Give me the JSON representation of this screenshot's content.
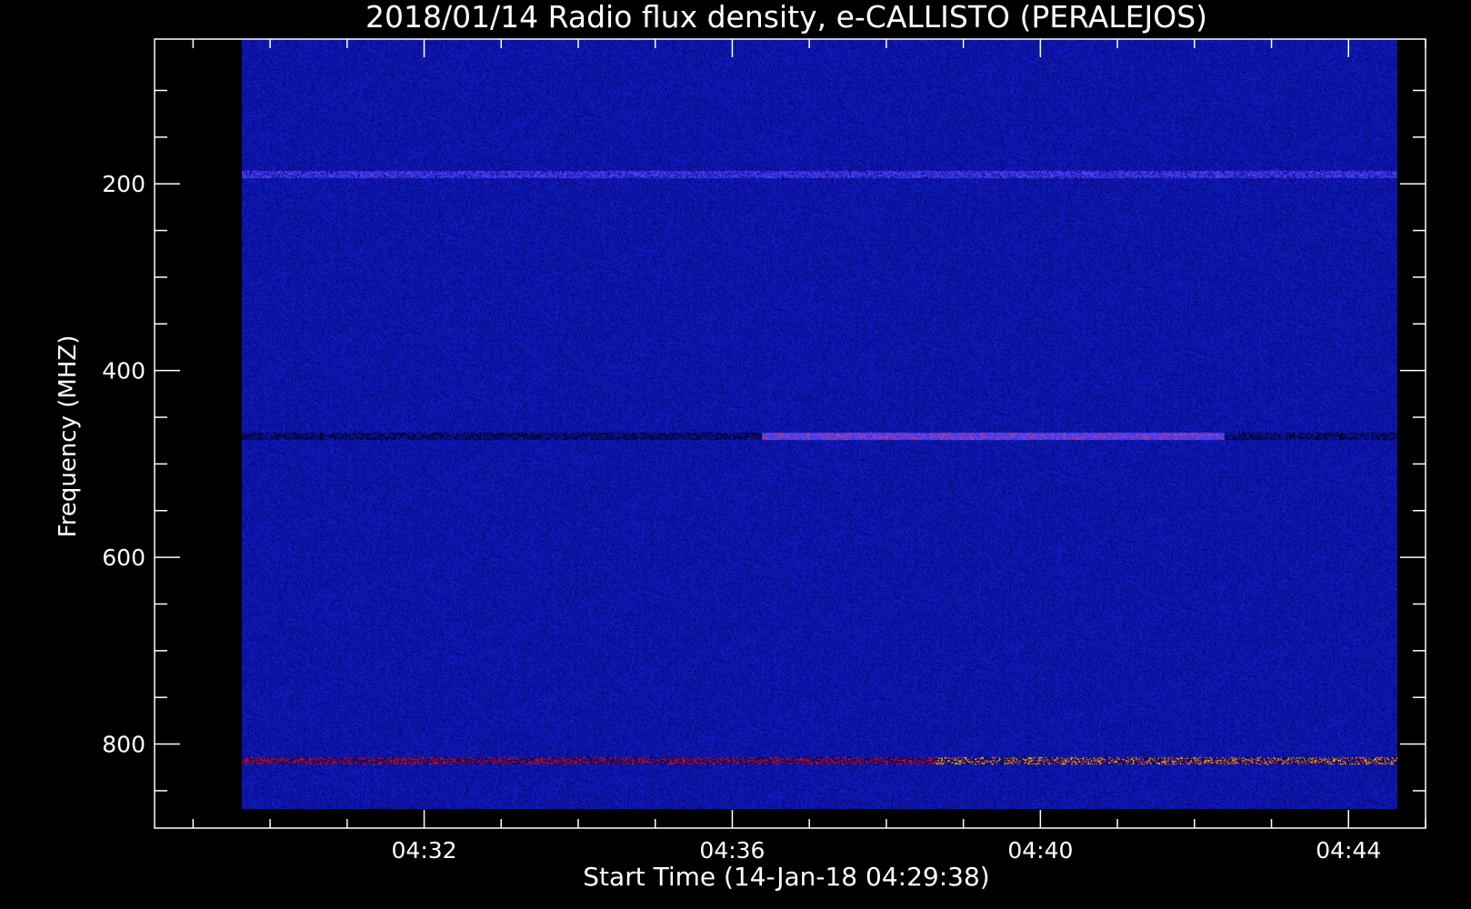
{
  "chart_data": {
    "type": "heatmap",
    "title": "2018/01/14  Radio flux density, e-CALLISTO (PERALEJOS)",
    "xlabel": "Start Time (14-Jan-18 04:29:38)",
    "ylabel": "Frequency (MHZ)",
    "x_axis": {
      "unit": "minutes of day",
      "range_minutes": [
        1228.5,
        1245.0
      ],
      "data_extent_minutes": [
        1229.63,
        1244.63
      ],
      "ticks": [
        {
          "minute": 1232,
          "label": "04:32"
        },
        {
          "minute": 1236,
          "label": "04:36"
        },
        {
          "minute": 1240,
          "label": "04:40"
        },
        {
          "minute": 1244,
          "label": "04:44"
        }
      ],
      "minor_tick_step_minutes": 1
    },
    "y_axis": {
      "unit": "MHz",
      "inverted": true,
      "range": [
        45,
        890
      ],
      "data_extent": [
        45,
        870
      ],
      "ticks": [
        {
          "value": 200,
          "label": "200"
        },
        {
          "value": 400,
          "label": "400"
        },
        {
          "value": 600,
          "label": "600"
        },
        {
          "value": 800,
          "label": "800"
        }
      ],
      "minor_tick_step": 50
    },
    "colors": {
      "background": "#000000",
      "axes": "#ffffff",
      "text": "#ffffff",
      "colormap": [
        "#000000",
        "#0a10a0",
        "#2a2ad8",
        "#ff2020",
        "#ffcc00"
      ]
    },
    "features": [
      {
        "name": "interference band",
        "frequency_mhz": 190,
        "time_start_minute": 1229.63,
        "time_end_minute": 1244.63,
        "intensity": 0.55
      },
      {
        "name": "interference band",
        "frequency_mhz": 470,
        "time_start_minute": 1229.63,
        "time_end_minute": 1244.63,
        "intensity": 0.75
      },
      {
        "name": "interference band",
        "frequency_mhz": 818,
        "time_start_minute": 1229.63,
        "time_end_minute": 1244.63,
        "intensity": 0.9
      }
    ],
    "grid": false,
    "legend": "none"
  }
}
